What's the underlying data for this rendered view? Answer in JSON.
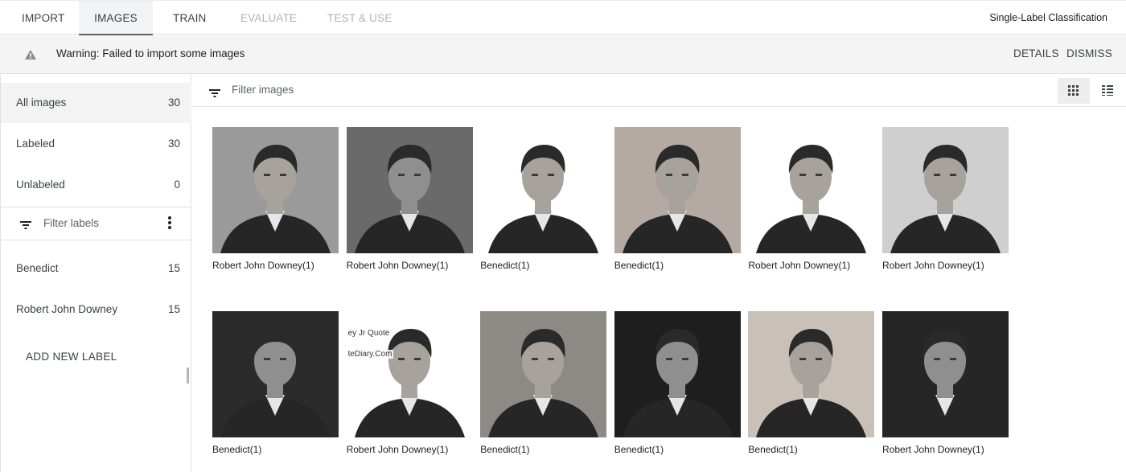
{
  "tabs": [
    {
      "label": "IMPORT",
      "state": "enabled"
    },
    {
      "label": "IMAGES",
      "state": "active"
    },
    {
      "label": "TRAIN",
      "state": "enabled"
    },
    {
      "label": "EVALUATE",
      "state": "disabled"
    },
    {
      "label": "TEST & USE",
      "state": "disabled"
    }
  ],
  "mode_label": "Single-Label Classification",
  "banner": {
    "icon": "warning-icon",
    "message": "Warning: Failed to import some images",
    "details_label": "DETAILS",
    "dismiss_label": "DISMISS"
  },
  "sidebar": {
    "status_items": [
      {
        "label": "All images",
        "count": "30",
        "selected": true
      },
      {
        "label": "Labeled",
        "count": "30",
        "selected": false
      },
      {
        "label": "Unlabeled",
        "count": "0",
        "selected": false
      }
    ],
    "filter_placeholder": "Filter labels",
    "labels": [
      {
        "label": "Benedict",
        "count": "15"
      },
      {
        "label": "Robert John Downey",
        "count": "15"
      }
    ],
    "add_label": "ADD NEW LABEL"
  },
  "main": {
    "filter_placeholder": "Filter images",
    "view_modes": [
      {
        "icon": "grid-view-icon",
        "active": true
      },
      {
        "icon": "list-view-icon",
        "active": false
      }
    ],
    "images": [
      {
        "caption": "Robert John Downey(1)",
        "tone": "#9a9a9a"
      },
      {
        "caption": "Robert John Downey(1)",
        "tone": "#6a6a6a"
      },
      {
        "caption": "Benedict(1)",
        "tone": "#ffffff"
      },
      {
        "caption": "Benedict(1)",
        "tone": "#b5aaa3"
      },
      {
        "caption": "Robert John Downey(1)",
        "tone": "#ffffff"
      },
      {
        "caption": "Robert John Downey(1)",
        "tone": "#cfcfcf"
      },
      {
        "caption": "Benedict(1)",
        "tone": "#2b2b2b"
      },
      {
        "caption": "Robert John Downey(1)",
        "tone": "#ffffff"
      },
      {
        "caption": "Benedict(1)",
        "tone": "#8d8a86"
      },
      {
        "caption": "Benedict(1)",
        "tone": "#1e1e1e"
      },
      {
        "caption": "Benedict(1)",
        "tone": "#c9c1b8"
      },
      {
        "caption": "Robert John Downey(1)",
        "tone": "#262626"
      }
    ],
    "image_overlay_text": [
      "ey Jr Quote",
      "teDiary.Com"
    ]
  }
}
